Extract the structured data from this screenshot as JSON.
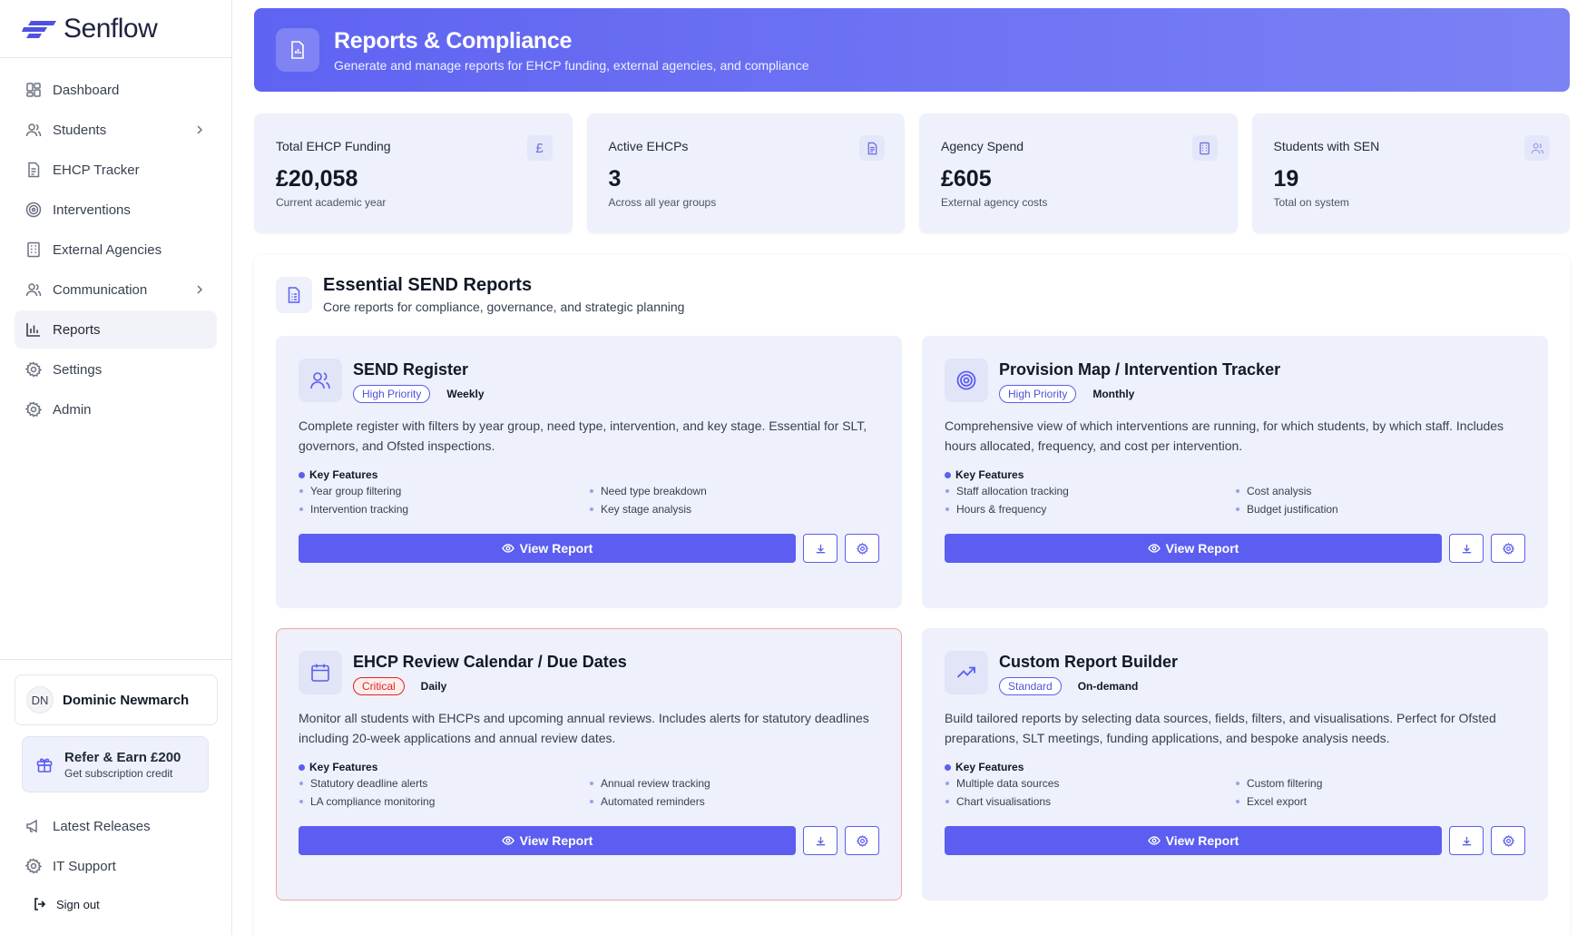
{
  "app": {
    "brand": "Senflow"
  },
  "sidebar": {
    "items": [
      {
        "label": "Dashboard",
        "icon": "dashboard-icon"
      },
      {
        "label": "Students",
        "icon": "users-icon"
      },
      {
        "label": "EHCP Tracker",
        "icon": "document-icon"
      },
      {
        "label": "Interventions",
        "icon": "target-icon"
      },
      {
        "label": "External Agencies",
        "icon": "building-icon"
      },
      {
        "label": "Communication",
        "icon": "users-icon"
      },
      {
        "label": "Reports",
        "icon": "bar-chart-icon"
      },
      {
        "label": "Settings",
        "icon": "gear-icon"
      },
      {
        "label": "Admin",
        "icon": "gear-icon"
      }
    ],
    "user": {
      "initials": "DN",
      "name": "Dominic Newmarch"
    },
    "refer": {
      "title": "Refer & Earn £200",
      "subtitle": "Get subscription credit"
    },
    "links": {
      "releases": "Latest Releases",
      "support": "IT Support",
      "signout": "Sign out"
    }
  },
  "header": {
    "title": "Reports & Compliance",
    "subtitle": "Generate and manage reports for EHCP funding, external agencies, and compliance"
  },
  "stats": [
    {
      "label": "Total EHCP Funding",
      "value": "£20,058",
      "sub": "Current academic year",
      "icon": "pound-icon"
    },
    {
      "label": "Active EHCPs",
      "value": "3",
      "sub": "Across all year groups",
      "icon": "document-icon"
    },
    {
      "label": "Agency Spend",
      "value": "£605",
      "sub": "External agency costs",
      "icon": "building-icon"
    },
    {
      "label": "Students with SEN",
      "value": "19",
      "sub": "Total on system",
      "icon": "users-icon"
    }
  ],
  "section": {
    "title": "Essential SEND Reports",
    "subtitle": "Core reports for compliance, governance, and strategic planning",
    "key_features_label": "Key Features",
    "view_label": "View Report"
  },
  "cards": [
    {
      "title": "SEND Register",
      "badge": "High Priority",
      "frequency": "Weekly",
      "description": "Complete register with filters by year group, need type, intervention, and key stage. Essential for SLT, governors, and Ofsted inspections.",
      "features": [
        "Year group filtering",
        "Need type breakdown",
        "Intervention tracking",
        "Key stage analysis"
      ]
    },
    {
      "title": "Provision Map / Intervention Tracker",
      "badge": "High Priority",
      "frequency": "Monthly",
      "description": "Comprehensive view of which interventions are running, for which students, by which staff. Includes hours allocated, frequency, and cost per intervention.",
      "features": [
        "Staff allocation tracking",
        "Cost analysis",
        "Hours & frequency",
        "Budget justification"
      ]
    },
    {
      "title": "EHCP Review Calendar / Due Dates",
      "badge": "Critical",
      "frequency": "Daily",
      "description": "Monitor all students with EHCPs and upcoming annual reviews. Includes alerts for statutory deadlines including 20-week applications and annual review dates.",
      "features": [
        "Statutory deadline alerts",
        "Annual review tracking",
        "LA compliance monitoring",
        "Automated reminders"
      ]
    },
    {
      "title": "Custom Report Builder",
      "badge": "Standard",
      "frequency": "On-demand",
      "description": "Build tailored reports by selecting data sources, fields, filters, and visualisations. Perfect for Ofsted preparations, SLT meetings, funding applications, and bespoke analysis needs.",
      "features": [
        "Multiple data sources",
        "Custom filtering",
        "Chart visualisations",
        "Excel export"
      ]
    }
  ]
}
